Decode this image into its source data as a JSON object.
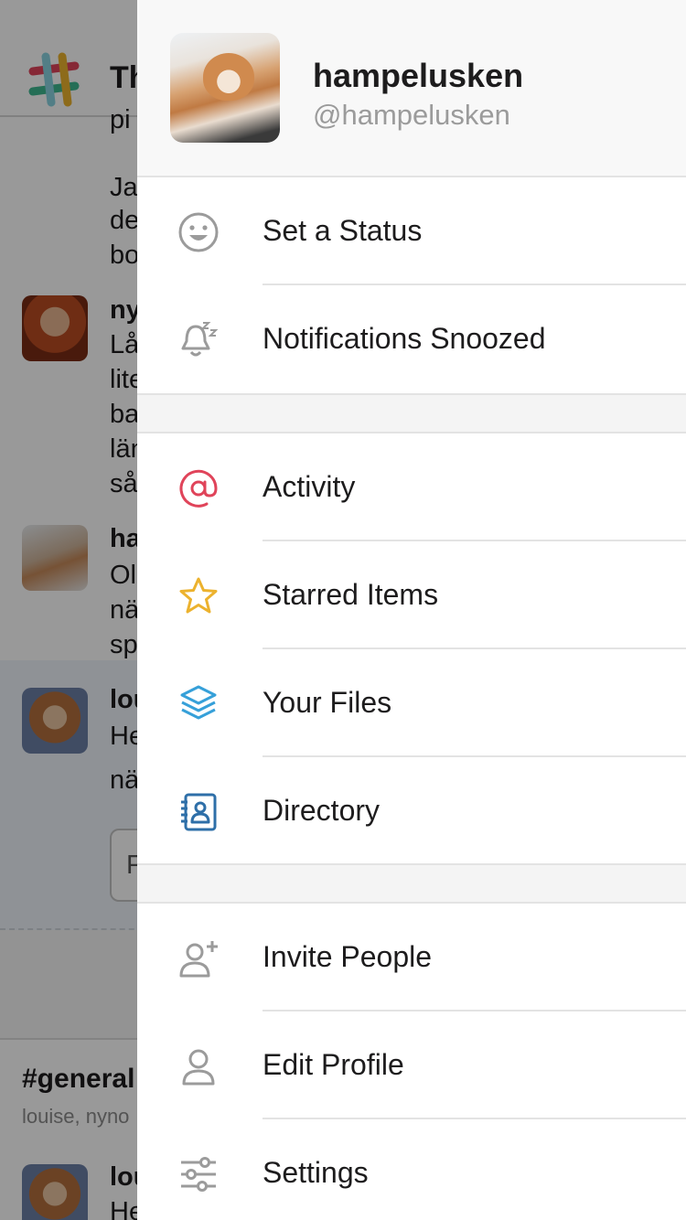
{
  "background": {
    "title_fragment": "Th",
    "fragments": [
      "pi",
      "Ja",
      "de",
      "bo",
      "ny",
      "Lå",
      "lite",
      "ba",
      "län",
      "så",
      "ha",
      "Ol",
      "nä",
      "sp",
      "lou",
      "He",
      "nä",
      "lou",
      "He"
    ],
    "input_fragment": "F",
    "channel": "#general",
    "members": "louise, nyno"
  },
  "profile": {
    "name": "hampelusken",
    "handle": "@hampelusken"
  },
  "menu": {
    "set_status": "Set a Status",
    "notifications": "Notifications Snoozed",
    "activity": "Activity",
    "starred": "Starred Items",
    "files": "Your Files",
    "directory": "Directory",
    "invite": "Invite People",
    "edit_profile": "Edit Profile",
    "settings": "Settings"
  },
  "icons": {
    "set_status": "smiley-face-icon",
    "notifications": "bell-snooze-icon",
    "activity": "at-sign-icon",
    "starred": "star-icon",
    "files": "layers-icon",
    "directory": "address-book-icon",
    "invite": "add-user-icon",
    "edit_profile": "user-icon",
    "settings": "sliders-icon"
  },
  "colors": {
    "activity_accent": "#e0445a",
    "star_accent": "#ecb22e",
    "files_accent": "#36a0d9",
    "directory_accent": "#2e6fa8",
    "icon_grey": "#9b9b9b"
  }
}
